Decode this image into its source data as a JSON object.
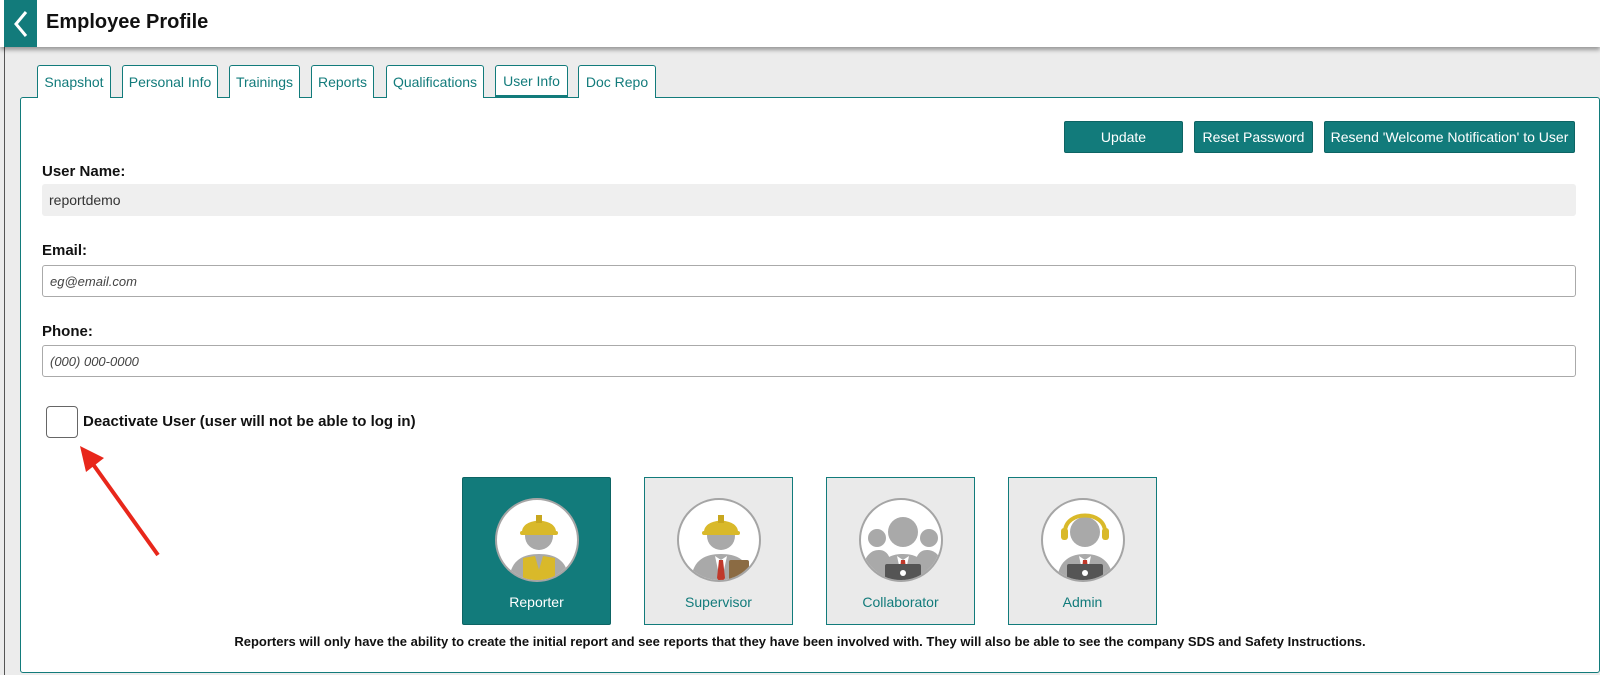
{
  "header": {
    "title": "Employee Profile"
  },
  "tabs": [
    {
      "label": "Snapshot"
    },
    {
      "label": "Personal Info"
    },
    {
      "label": "Trainings"
    },
    {
      "label": "Reports"
    },
    {
      "label": "Qualifications"
    },
    {
      "label": "User Info"
    },
    {
      "label": "Doc Repo"
    }
  ],
  "active_tab": "User Info",
  "actions": {
    "update": "Update",
    "reset_password": "Reset Password",
    "resend": "Resend 'Welcome Notification' to User"
  },
  "form": {
    "username_label": "User Name:",
    "username_value": "reportdemo",
    "email_label": "Email:",
    "email_placeholder": "eg@email.com",
    "phone_label": "Phone:",
    "phone_placeholder": "(000) 000-0000",
    "deactivate_label": "Deactivate User (user will not be able to log in)"
  },
  "roles": [
    {
      "label": "Reporter",
      "selected": true
    },
    {
      "label": "Supervisor",
      "selected": false
    },
    {
      "label": "Collaborator",
      "selected": false
    },
    {
      "label": "Admin",
      "selected": false
    }
  ],
  "role_description": "Reporters will only have the ability to create the initial report and see reports that they have been involved with. They will also be able to see the company SDS and Safety Instructions.",
  "colors": {
    "accent": "#127b7b",
    "hardhat": "#d9b92a",
    "arrow": "#e8271b"
  }
}
